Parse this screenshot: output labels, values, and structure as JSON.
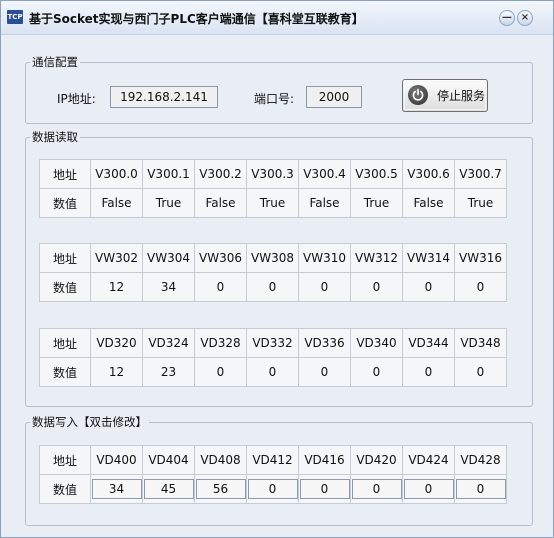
{
  "window": {
    "app_icon_text": "TCP",
    "title": "基于Socket实现与西门子PLC客户端通信【喜科堂互联教育】",
    "min_symbol": "—",
    "close_symbol": "×"
  },
  "comm": {
    "group_title": "通信配置",
    "ip_label": "IP地址:",
    "ip_value": "192.168.2.141",
    "port_label": "端口号:",
    "port_value": "2000",
    "button_label": "停止服务"
  },
  "read": {
    "group_title": "数据读取",
    "tables": [
      {
        "addr_label": "地址",
        "value_label": "数值",
        "addresses": [
          "V300.0",
          "V300.1",
          "V300.2",
          "V300.3",
          "V300.4",
          "V300.5",
          "V300.6",
          "V300.7"
        ],
        "values": [
          "False",
          "True",
          "False",
          "True",
          "False",
          "True",
          "False",
          "True"
        ]
      },
      {
        "addr_label": "地址",
        "value_label": "数值",
        "addresses": [
          "VW302",
          "VW304",
          "VW306",
          "VW308",
          "VW310",
          "VW312",
          "VW314",
          "VW316"
        ],
        "values": [
          "12",
          "34",
          "0",
          "0",
          "0",
          "0",
          "0",
          "0"
        ]
      },
      {
        "addr_label": "地址",
        "value_label": "数值",
        "addresses": [
          "VD320",
          "VD324",
          "VD328",
          "VD332",
          "VD336",
          "VD340",
          "VD344",
          "VD348"
        ],
        "values": [
          "12",
          "23",
          "0",
          "0",
          "0",
          "0",
          "0",
          "0"
        ]
      }
    ]
  },
  "write": {
    "group_title": "数据写入【双击修改】",
    "addr_label": "地址",
    "value_label": "数值",
    "addresses": [
      "VD400",
      "VD404",
      "VD408",
      "VD412",
      "VD416",
      "VD420",
      "VD424",
      "VD428"
    ],
    "values": [
      "34",
      "45",
      "56",
      "0",
      "0",
      "0",
      "0",
      "0"
    ]
  }
}
